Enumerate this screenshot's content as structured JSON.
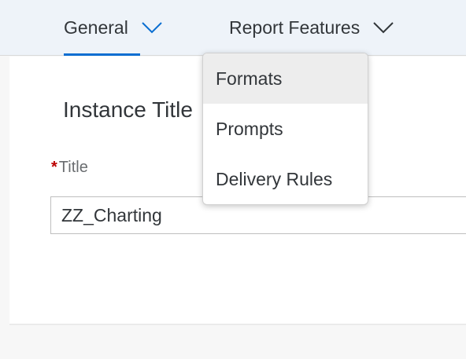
{
  "tabs": [
    {
      "label": "General",
      "selected": true
    },
    {
      "label": "Report Features",
      "selected": false
    }
  ],
  "section": {
    "title": "Instance Title"
  },
  "form": {
    "required_marker": "*",
    "title_label": "Title",
    "title_value": "ZZ_Charting"
  },
  "menu": {
    "items": [
      {
        "label": "Formats",
        "highlighted": true
      },
      {
        "label": "Prompts",
        "highlighted": false
      },
      {
        "label": "Delivery Rules",
        "highlighted": false
      }
    ]
  },
  "colors": {
    "accent": "#0a6ed1",
    "required": "#bb0000",
    "tabbar_bg": "#eef3f9"
  }
}
